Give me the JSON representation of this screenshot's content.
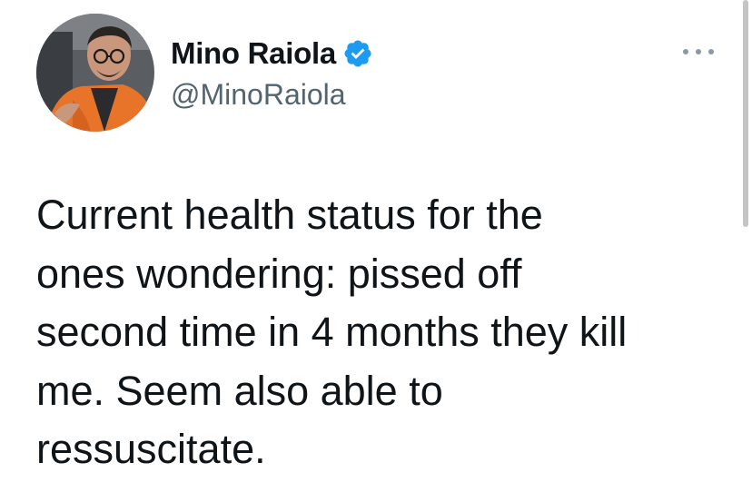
{
  "tweet": {
    "author": {
      "display_name": "Mino Raiola",
      "handle": "@MinoRaiola",
      "verified": true,
      "avatar_icon": "profile-photo",
      "verified_icon": "verified-badge-icon"
    },
    "more_icon": "more-options-icon",
    "text_lines": [
      "Current health status for the",
      "ones wondering: pissed off",
      "second time in 4 months they kill",
      "me. Seem also able to",
      "ressuscitate."
    ]
  },
  "colors": {
    "text": "#0f1419",
    "secondary_text": "#536471",
    "verified_blue": "#1d9bf0",
    "background": "#ffffff"
  }
}
